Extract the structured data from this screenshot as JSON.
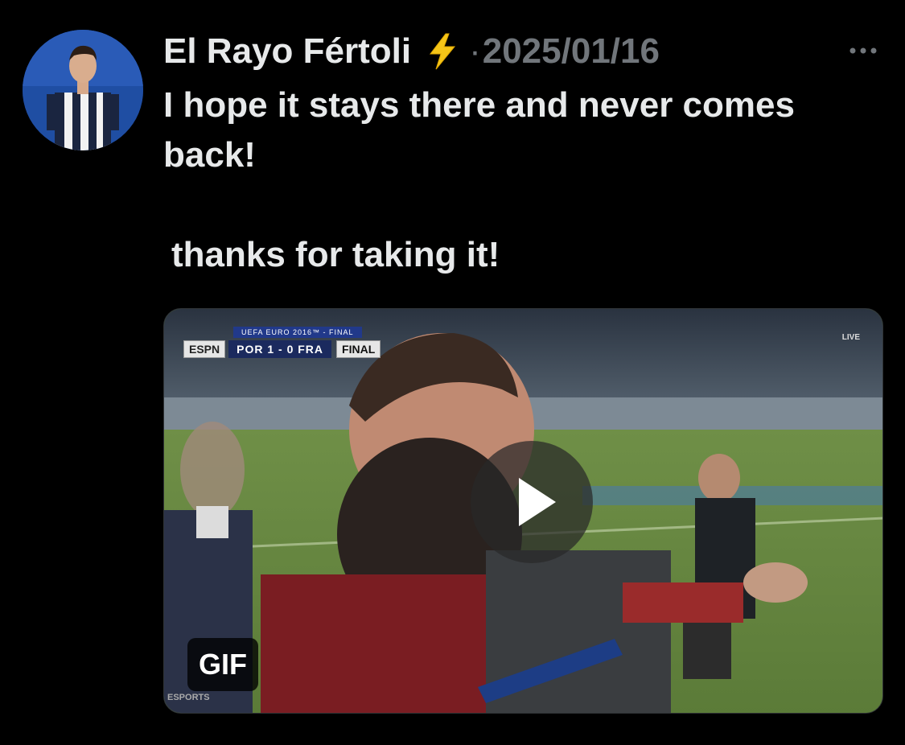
{
  "tweet": {
    "author": {
      "display_name": "El Rayo Fértoli",
      "emoji": "⚡",
      "avatar_icon": "player-avatar"
    },
    "separator": "·",
    "timestamp": "2025/01/16",
    "more_icon": "more-horizontal-icon",
    "text_line1": "I hope it stays there and never comes back!",
    "text_line2": "thanks for taking it!",
    "media": {
      "type": "gif",
      "badge": "GIF",
      "scorebug": {
        "network": "ESPN",
        "header": "UEFA EURO 2016™ - FINAL",
        "score": "POR 1 - 0 FRA",
        "status": "FINAL"
      },
      "channel_watermark": "ESPORTS",
      "play_icon": "play-icon"
    }
  },
  "colors": {
    "background": "#000000",
    "primary_text": "#e7e9ea",
    "secondary_text": "#71767b",
    "bolt": "#f5c518"
  }
}
